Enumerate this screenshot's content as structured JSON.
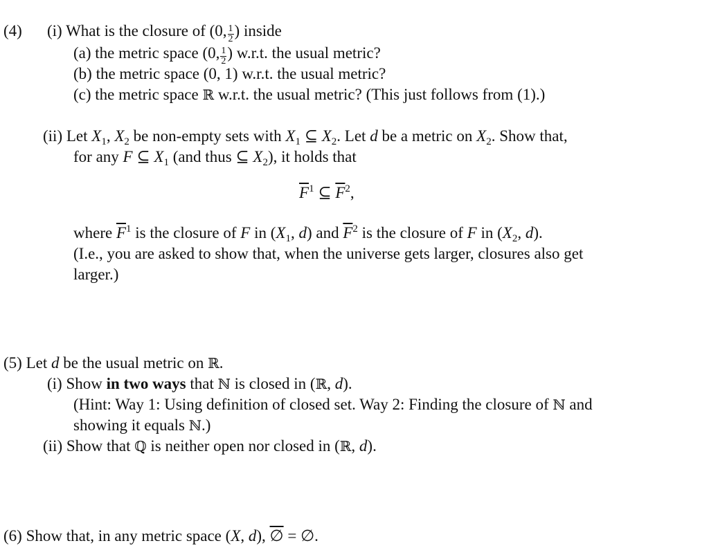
{
  "problem4": {
    "number": "(4)",
    "part_i": {
      "label": "(i)",
      "text_before": "What is the closure of (0,",
      "frac_num": "1",
      "frac_den": "2",
      "text_after": ") inside",
      "a": {
        "label": "(a)",
        "text_before": "the metric space (0,",
        "frac_num": "1",
        "frac_den": "2",
        "text_after": ") w.r.t.  the usual metric?"
      },
      "b": {
        "label": "(b)",
        "text": "the metric space (0, 1) w.r.t.  the usual metric?"
      },
      "c": {
        "label": "(c)",
        "text_before": "the metric space",
        "symbol": "ℝ",
        "text_after": "w.r.t.  the usual metric?  (This just follows from (1).)"
      }
    },
    "part_ii": {
      "label": "(ii)",
      "line1": {
        "t1": "Let",
        "x1": "X",
        "s1": "1",
        "t2": ",",
        "x2": "X",
        "s2": "2",
        "t3": "be non-empty sets with",
        "x3": "X",
        "s3": "1",
        "t4": "⊆",
        "x4": "X",
        "s4": "2",
        "t5": ".  Let",
        "d": "d",
        "t6": "be a metric on",
        "x5": "X",
        "s5": "2",
        "t7": ".  Show that,"
      },
      "line2": {
        "t1": "for any",
        "f": "F",
        "t2": "⊆",
        "x1": "X",
        "s1": "1",
        "t3": "(and thus ⊆",
        "x2": "X",
        "s2": "2",
        "t4": "), it holds that"
      },
      "display": {
        "f1": "F",
        "sup1": "1",
        "rel": "⊆",
        "f2": "F",
        "sup2": "2",
        "tail": ","
      },
      "line3": {
        "t1": "where",
        "f1": "F",
        "sup1": "1",
        "t2": "is the closure of",
        "f2": "F",
        "t3": "in (",
        "x1": "X",
        "s1": "1",
        "t4": ",",
        "d1": "d",
        "t5": ") and",
        "f3": "F",
        "sup2": "2",
        "t6": "is the closure of",
        "f4": "F",
        "t7": "in (",
        "x2": "X",
        "s2": "2",
        "t8": ",",
        "d2": "d",
        "t9": ")."
      },
      "line4": "(I.e., you are asked to show that, when the universe gets larger, closures also get",
      "line5": "larger.)"
    }
  },
  "problem5": {
    "number": "(5)",
    "intro_before": "Let",
    "intro_d": "d",
    "intro_after": "be the usual metric on",
    "intro_R": "ℝ",
    "intro_end": ".",
    "part_i": {
      "label": "(i)",
      "t1": "Show",
      "bold": "in two ways",
      "t2": "that",
      "N": "ℕ",
      "t3": "is closed in (",
      "R": "ℝ",
      "t4": ",",
      "d": "d",
      "t5": ").",
      "hint1_before": "(Hint:  Way 1:  Using definition of closed set.  Way 2:  Finding the closure of",
      "hint1_N": "ℕ",
      "hint1_after": "and",
      "hint2_before": "showing it equals",
      "hint2_N": "ℕ",
      "hint2_after": ".)"
    },
    "part_ii": {
      "label": "(ii)",
      "t1": "Show that",
      "Q": "ℚ",
      "t2": "is neither open nor closed in (",
      "R": "ℝ",
      "t3": ",",
      "d": "d",
      "t4": ")."
    }
  },
  "problem6": {
    "number": "(6)",
    "t1": "Show that, in any metric space (",
    "X": "X",
    "t2": ",",
    "d": "d",
    "t3": "),",
    "empty1": "∅",
    "eq": "=",
    "empty2": "∅",
    "end": "."
  }
}
